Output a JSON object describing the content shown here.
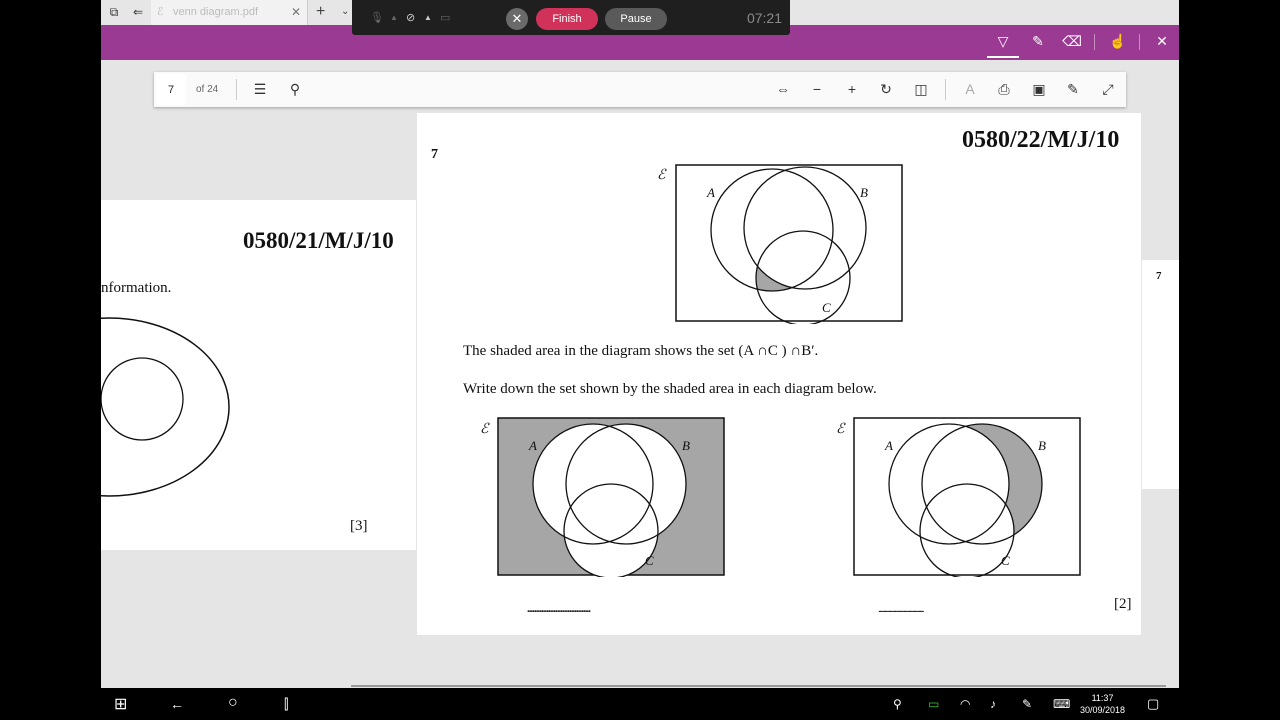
{
  "browser": {
    "tab_title": "venn diagram.pdf",
    "tab_close": "✕",
    "new_tab": "+",
    "tab_menu": "⌄"
  },
  "recorder": {
    "finish_label": "Finish",
    "pause_label": "Pause",
    "close_label": "✕",
    "timer": "07:21"
  },
  "pdf_toolbar": {
    "page_number": "7",
    "page_count": "of 24"
  },
  "left_page": {
    "paper_code": "0580/21/M/J/10",
    "partial_text": "nformation.",
    "marks": "[3]"
  },
  "right_page": {
    "question_number": "7",
    "paper_code": "0580/22/M/J/10",
    "universal_symbol": "ℰ",
    "labels": {
      "a": "A",
      "b": "B",
      "c": "C"
    },
    "statement": "The shaded area in the diagram shows the set (A ∩C ) ∩B′.",
    "instruction": "Write down the set shown by the shaded area in each diagram below.",
    "answer_line": "....................................",
    "marks": "[2]"
  },
  "next_page": {
    "number": "7"
  },
  "taskbar": {
    "time": "11:37",
    "date": "30/09/2018"
  },
  "colors": {
    "accent_purple": "#9b3a93",
    "finish_red": "#d1325a",
    "shade_gray": "#a6a6a6"
  }
}
